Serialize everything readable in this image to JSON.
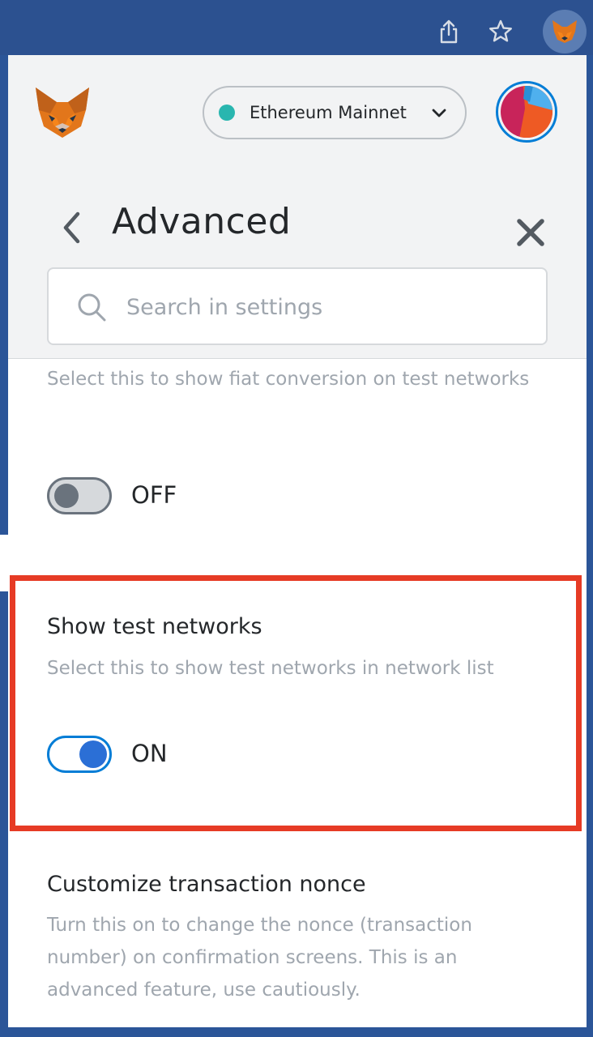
{
  "network": {
    "name": "Ethereum Mainnet",
    "dot_color": "#29b6af"
  },
  "header": {
    "title": "Advanced"
  },
  "search": {
    "placeholder": "Search in settings",
    "value": ""
  },
  "settings": [
    {
      "title": "",
      "description": "Select this to show fiat conversion on test networks",
      "state_label": "OFF",
      "enabled": false
    },
    {
      "title": "Show test networks",
      "description": "Select this to show test networks in network list",
      "state_label": "ON",
      "enabled": true,
      "highlighted": true
    },
    {
      "title": "Customize transaction nonce",
      "description": "Turn this on to change the nonce (transaction number) on confirmation screens. This is an advanced feature, use cautiously."
    }
  ],
  "colors": {
    "highlight": "#e63b25",
    "accent": "#037dd6",
    "toggle_on_knob": "#2b6fd6"
  },
  "icons": {
    "share": "share-icon",
    "star": "star-icon",
    "extension": "metamask-fox-icon",
    "back": "chevron-left-icon",
    "close": "close-icon",
    "search": "search-icon",
    "dropdown": "chevron-down-icon"
  }
}
